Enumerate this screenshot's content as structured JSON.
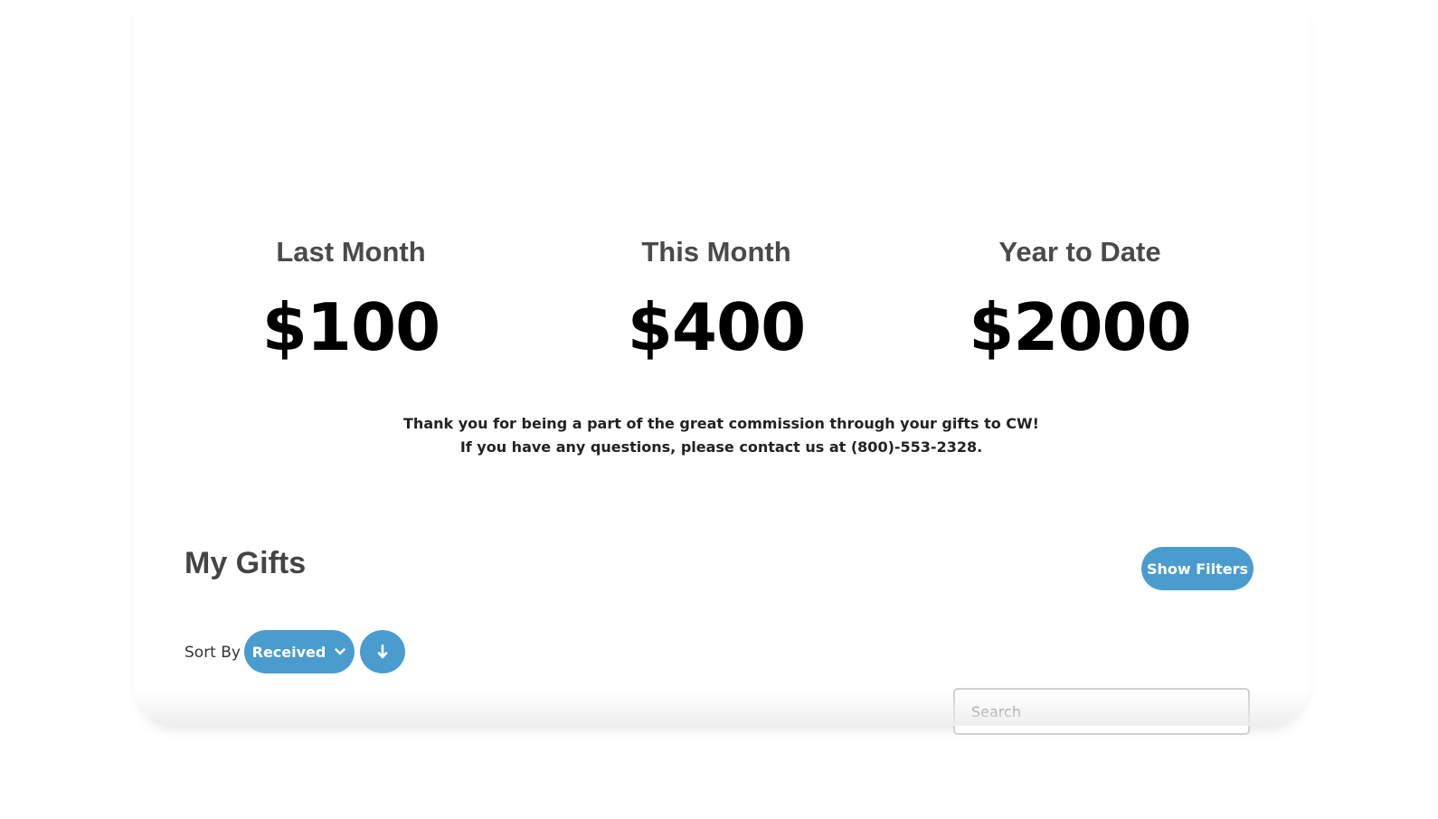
{
  "stats": [
    {
      "label": "Last Month",
      "value": "$100"
    },
    {
      "label": "This Month",
      "value": "$400"
    },
    {
      "label": "Year to Date",
      "value": "$2000"
    }
  ],
  "message": {
    "line1": "Thank you for being a part of the great commission through your gifts to CW!",
    "line2": "If you have any questions, please contact us at (800)-553-2328."
  },
  "gifts": {
    "title": "My Gifts",
    "show_filters_label": "Show Filters",
    "sort_by_label": "Sort By",
    "sort_selected": "Received",
    "sort_direction_icon": "arrow-down-icon",
    "search_placeholder": "Search",
    "search_value": ""
  },
  "colors": {
    "accent": "#4a9ccf",
    "heading": "#4a4a4a",
    "value": "#000000"
  }
}
